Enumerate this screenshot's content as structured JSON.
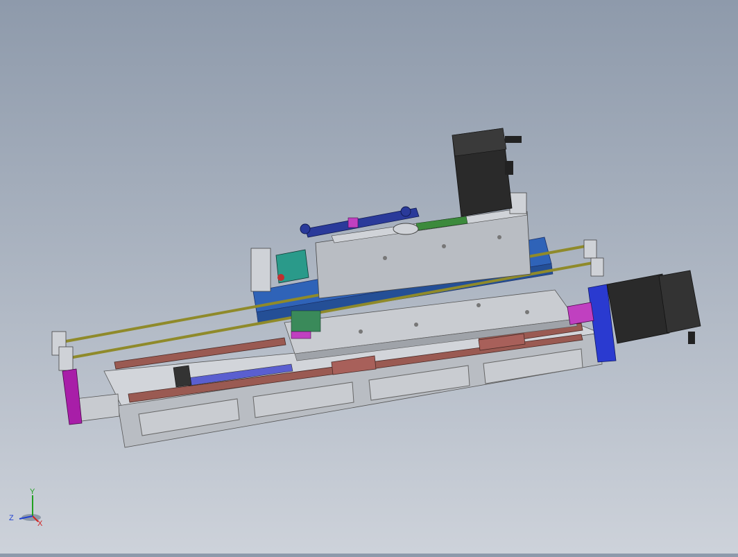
{
  "viewport": {
    "background_top": "#8e9aab",
    "background_bottom": "#cdd2da"
  },
  "model": {
    "colors": {
      "frame_grey": "#c5c8cd",
      "frame_shadow": "#8d9096",
      "rail_red": "#9a5a52",
      "carriage_blue": "#2f63b8",
      "plate_grey": "#bfc3c8",
      "motor_black": "#262626",
      "rod_olive": "#8f8a2a",
      "bracket_magenta": "#a81ea8",
      "coupling_green": "#2a9a8a",
      "belt_green": "#3c8a3c",
      "link_blue": "#2a3a9a"
    }
  },
  "triad": {
    "x_label": "X",
    "y_label": "Y",
    "z_label": "Z",
    "x_color": "#d02020",
    "y_color": "#20a020",
    "z_color": "#2040d0"
  }
}
